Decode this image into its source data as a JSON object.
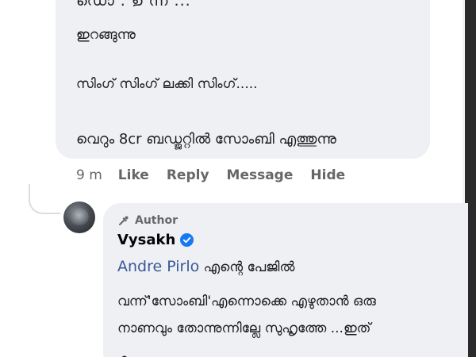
{
  "comment1": {
    "cut_top_line": "ഡൊ . ഉ ന്ന ...",
    "lines": [
      "ഇറങ്ങുന്നു",
      "സിംഗ് സിംഗ് ലക്കി സിംഗ്.....",
      "വെറും 8cr ബഡ്ജറ്റിൽ സോംബി എത്തുന്നു"
    ],
    "actions": {
      "time": "9 m",
      "like": "Like",
      "reply": "Reply",
      "message": "Message",
      "hide": "Hide"
    }
  },
  "reply": {
    "author_badge": "Author",
    "name": "Vysakh",
    "mention": "Andre Pirlo",
    "line1_rest": " എന്റെ പേജിൽ",
    "line2": "വന്ന്'സോംബി'എന്നൊക്കെ എഴുതാൻ ഒരു",
    "line3": "നാണവും തോന്നുന്നില്ലേ സുഹൃത്തേ ...ഇത്",
    "line4_cut": "ക ...."
  },
  "colors": {
    "bubble": "#eff0f3",
    "mention": "#385898",
    "verified": "#1877f2",
    "muted": "#65676b"
  },
  "icons": {
    "author": "author-badge-icon",
    "verified": "verified-badge-icon"
  }
}
